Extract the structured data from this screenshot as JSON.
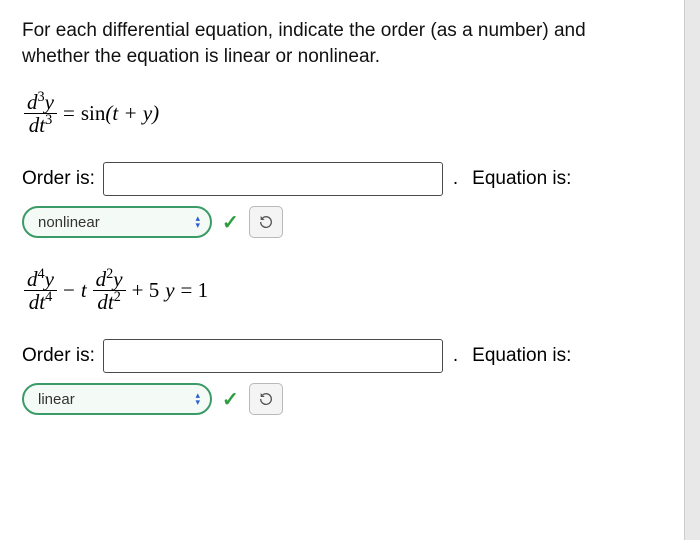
{
  "prompt": "For each differential equation, indicate the order (as a number) and whether the equation is linear or nonlinear.",
  "q1": {
    "equation_tex": "d^3y/dt^3 = sin(t + y)",
    "order_label": "Order is:",
    "order_value": "",
    "period": ".",
    "eq_label": "Equation is:",
    "select_value": "nonlinear",
    "select_options": [
      "linear",
      "nonlinear"
    ],
    "correct": true
  },
  "q2": {
    "equation_tex": "d^4y/dt^4 - t d^2y/dt^2 + 5y = 1",
    "order_label": "Order is:",
    "order_value": "",
    "period": ".",
    "eq_label": "Equation is:",
    "select_value": "linear",
    "select_options": [
      "linear",
      "nonlinear"
    ],
    "correct": true
  },
  "icons": {
    "check": "✓",
    "caret_up": "▴",
    "caret_down": "▾"
  }
}
